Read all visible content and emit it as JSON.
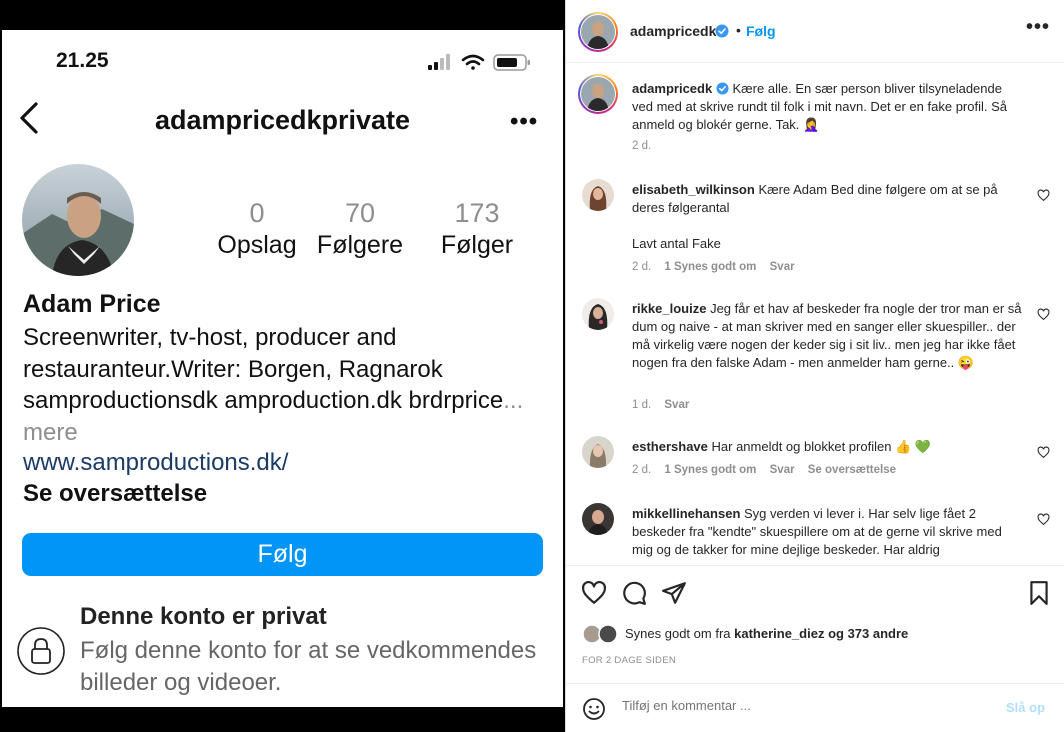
{
  "phone": {
    "status_time": "21.25",
    "profile_handle": "adampricedkprivate",
    "more": "•••",
    "stats": [
      {
        "num": "0",
        "label": "Opslag"
      },
      {
        "num": "70",
        "label": "Følgere"
      },
      {
        "num": "173",
        "label": "Følger"
      }
    ],
    "bio_name": "Adam Price",
    "bio_text": "Screenwriter, tv-host, producer and restauranteur.Writer: Borgen, Ragnarok samproductionsdk amproduction.dk brdrprice",
    "bio_more": "... mere",
    "bio_link": "www.samproductions.dk/",
    "translate": "Se oversættelse",
    "follow_button": "Følg",
    "private_title": "Denne konto er privat",
    "private_sub": "Følg denne konto for at se vedkommendes billeder og videoer."
  },
  "post": {
    "header": {
      "username": "adampricedk",
      "dot": "•",
      "follow": "Følg",
      "more": "•••"
    },
    "caption": {
      "username": "adampricedk",
      "text": "Kære alle. En sær person bliver tilsyneladende ved med at skrive rundt til folk i mit navn. Det er en fake profil. Så anmeld og blokér gerne. Tak. 🤦‍♀️",
      "time": "2 d."
    },
    "comments": [
      {
        "username": "elisabeth_wilkinson",
        "text": "Kære Adam Bed dine følgere om at se på deres følgerantal",
        "text2": "Lavt antal Fake",
        "time": "2 d.",
        "likes": "1 Synes godt om",
        "reply": "Svar",
        "translate": ""
      },
      {
        "username": "rikke_louize",
        "text": "Jeg får et hav af beskeder fra nogle der tror man er så dum og naive - at man skriver med en sanger eller skuespiller.. der må virkelig være nogen der keder sig i sit liv.. men jeg har ikke fået nogen fra den falske Adam - men anmelder ham gerne.. 😜",
        "time": "1 d.",
        "likes": "",
        "reply": "Svar",
        "translate": ""
      },
      {
        "username": "esthershave",
        "text": "Har anmeldt og blokket profilen 👍 💚",
        "time": "2 d.",
        "likes": "1 Synes godt om",
        "reply": "Svar",
        "translate": "Se oversættelse"
      },
      {
        "username": "mikkellinehansen",
        "text": "Syg verden vi lever i. Har selv lige fået 2 beskeder fra \"kendte\" skuespillere om at de gerne vil skrive med mig og de takker for mine dejlige beskeder. Har aldrig"
      }
    ],
    "likes": {
      "prefix": "Synes godt om fra",
      "user": "katherine_diez",
      "suffix": "og 373 andre"
    },
    "date": "FOR 2 DAGE SIDEN",
    "add_comment": {
      "placeholder": "Tilføj en kommentar ...",
      "post_label": "Slå op"
    }
  },
  "colors": {
    "accent": "#0095f6",
    "follow_button_bg": "#0095f6",
    "muted": "#8e8e8e"
  }
}
